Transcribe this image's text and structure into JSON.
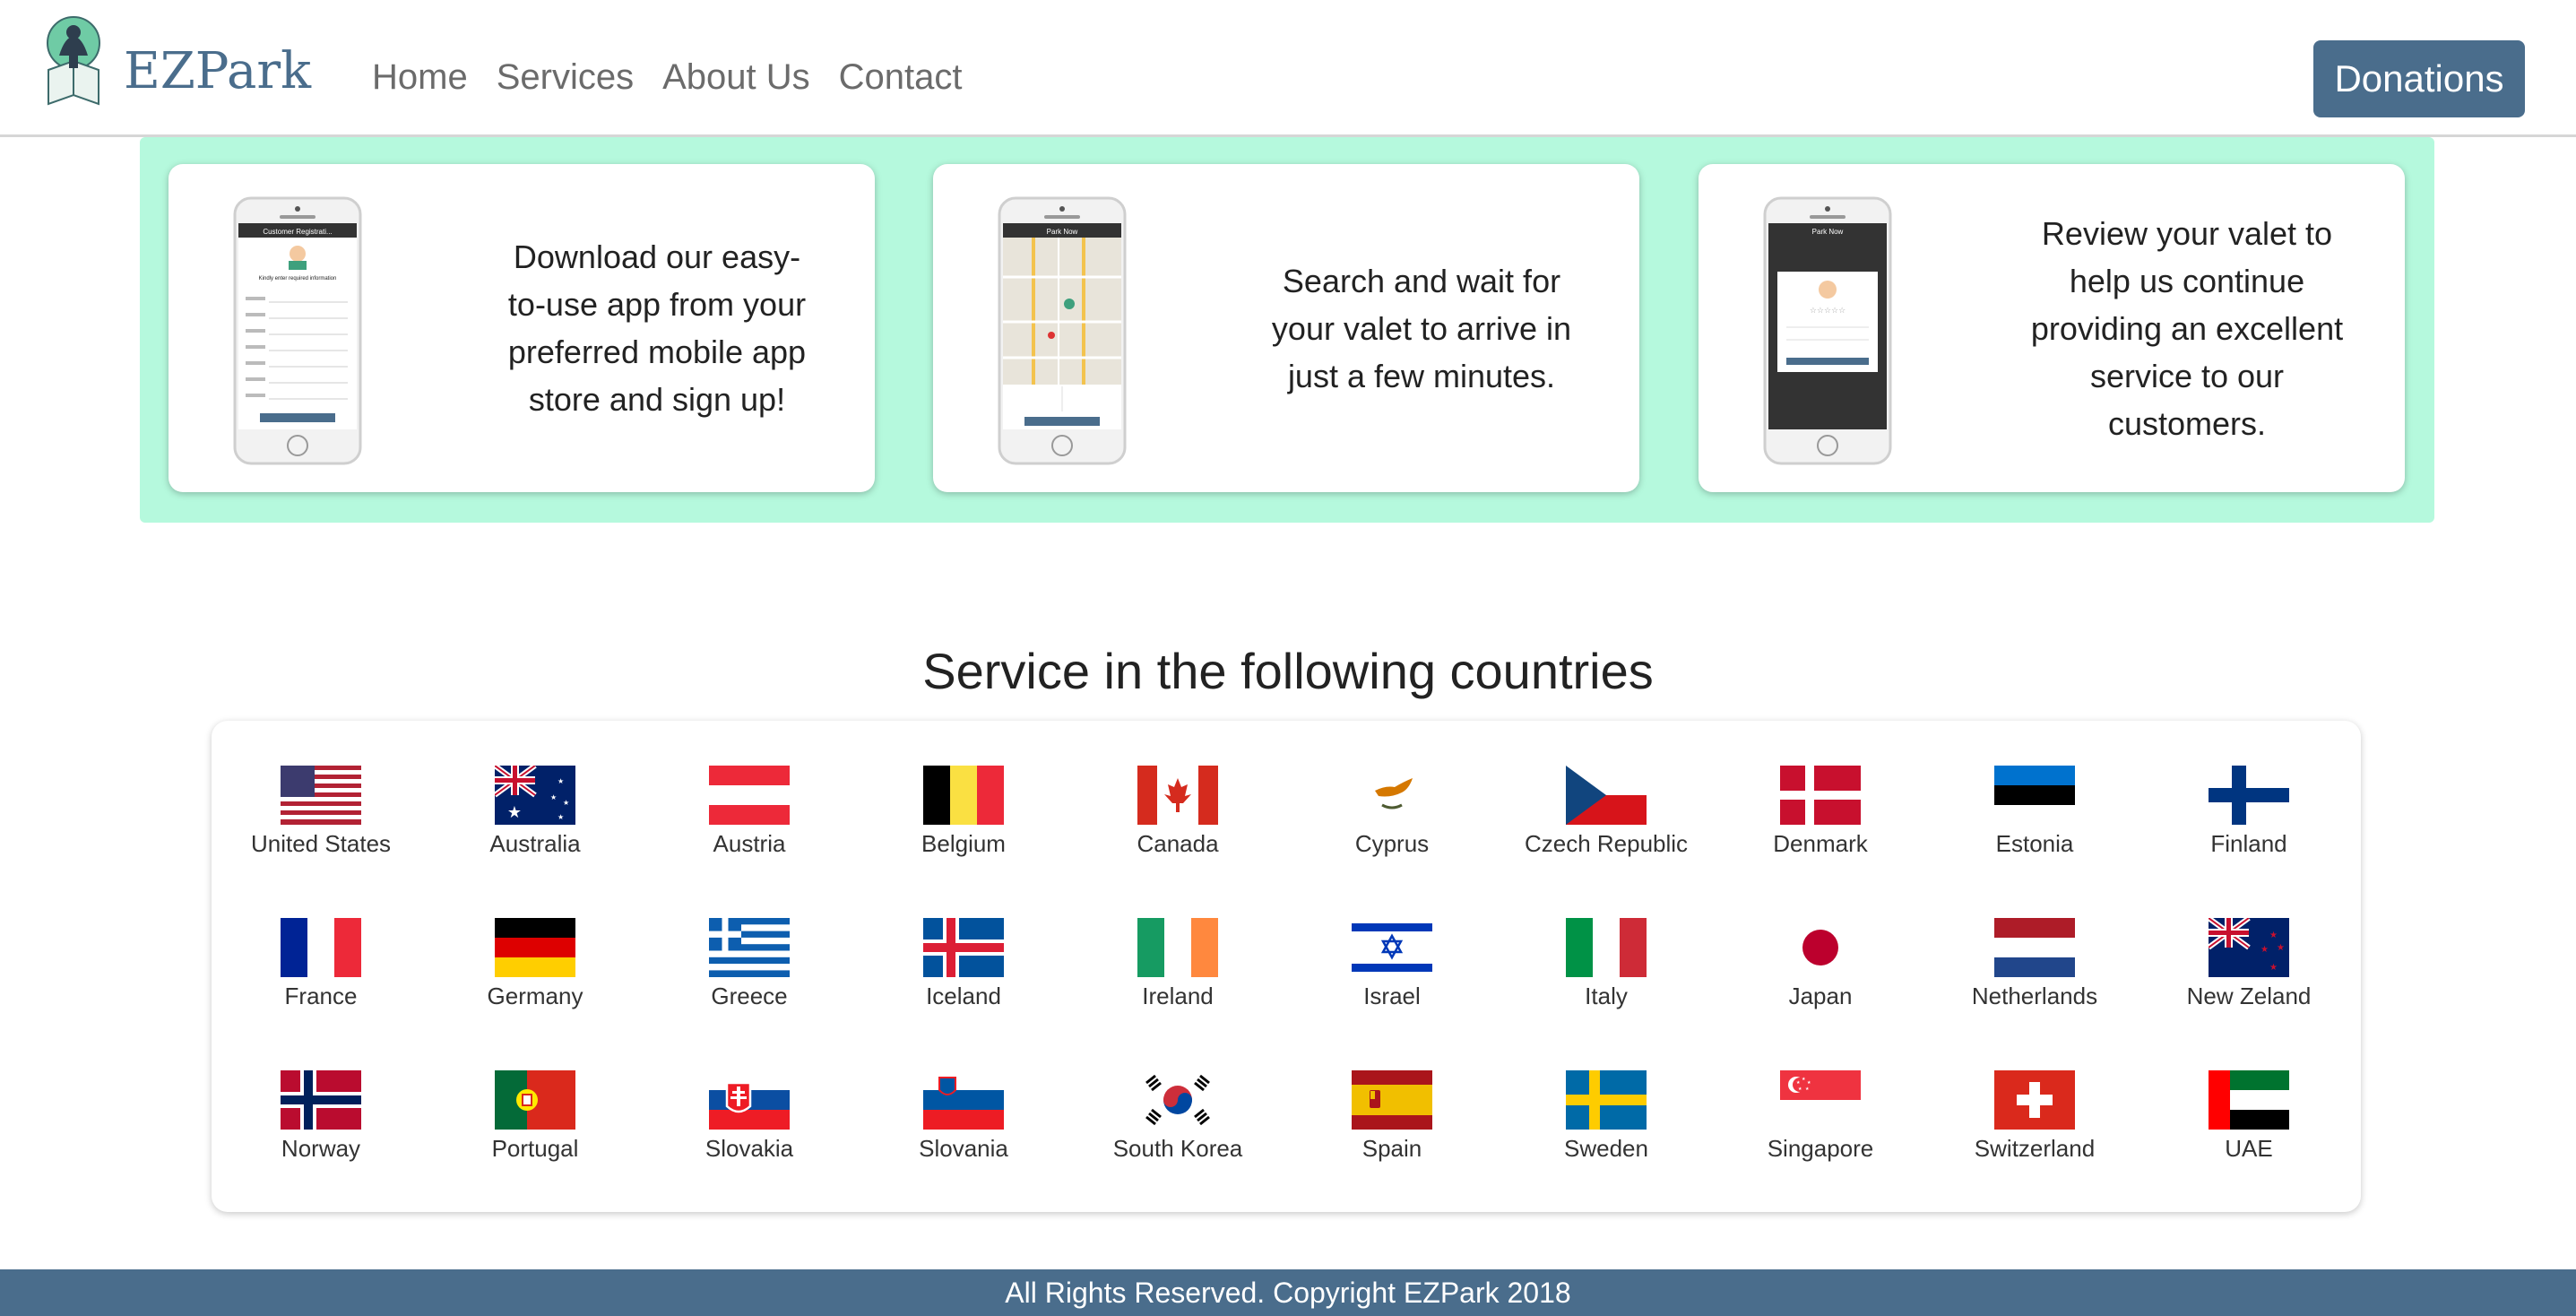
{
  "brand": {
    "name": "EZPark"
  },
  "nav": {
    "links": [
      "Home",
      "Services",
      "About Us",
      "Contact"
    ],
    "donate_label": "Donations"
  },
  "steps": [
    {
      "text": "Download our easy-to-use app from your preferred mobile app store and sign up!",
      "screen_title": "Customer Registrati...",
      "screen_subtitle": "Kindly enter required information"
    },
    {
      "text": "Search and wait for your valet to arrive in just a few minutes.",
      "screen_title": "Park Now"
    },
    {
      "text": "Review your valet to help us continue providing an excellent service to our customers.",
      "screen_title": "Park Now"
    }
  ],
  "countries": {
    "title": "Service in the following countries",
    "items": [
      {
        "name": "United States",
        "icon": "flag-us-icon"
      },
      {
        "name": "Australia",
        "icon": "flag-australia-icon"
      },
      {
        "name": "Austria",
        "icon": "flag-austria-icon"
      },
      {
        "name": "Belgium",
        "icon": "flag-belgium-icon"
      },
      {
        "name": "Canada",
        "icon": "flag-canada-icon"
      },
      {
        "name": "Cyprus",
        "icon": "flag-cyprus-icon"
      },
      {
        "name": "Czech Republic",
        "icon": "flag-czech-icon"
      },
      {
        "name": "Denmark",
        "icon": "flag-denmark-icon"
      },
      {
        "name": "Estonia",
        "icon": "flag-estonia-icon"
      },
      {
        "name": "Finland",
        "icon": "flag-finland-icon"
      },
      {
        "name": "France",
        "icon": "flag-france-icon"
      },
      {
        "name": "Germany",
        "icon": "flag-germany-icon"
      },
      {
        "name": "Greece",
        "icon": "flag-greece-icon"
      },
      {
        "name": "Iceland",
        "icon": "flag-iceland-icon"
      },
      {
        "name": "Ireland",
        "icon": "flag-ireland-icon"
      },
      {
        "name": "Israel",
        "icon": "flag-israel-icon"
      },
      {
        "name": "Italy",
        "icon": "flag-italy-icon"
      },
      {
        "name": "Japan",
        "icon": "flag-japan-icon"
      },
      {
        "name": "Netherlands",
        "icon": "flag-netherlands-icon"
      },
      {
        "name": "New Zeland",
        "icon": "flag-new-zealand-icon"
      },
      {
        "name": "Norway",
        "icon": "flag-norway-icon"
      },
      {
        "name": "Portugal",
        "icon": "flag-portugal-icon"
      },
      {
        "name": "Slovakia",
        "icon": "flag-slovakia-icon"
      },
      {
        "name": "Slovania",
        "icon": "flag-slovenia-icon"
      },
      {
        "name": "South Korea",
        "icon": "flag-south-korea-icon"
      },
      {
        "name": "Spain",
        "icon": "flag-spain-icon"
      },
      {
        "name": "Sweden",
        "icon": "flag-sweden-icon"
      },
      {
        "name": "Singapore",
        "icon": "flag-singapore-icon"
      },
      {
        "name": "Switzerland",
        "icon": "flag-switzerland-icon"
      },
      {
        "name": "UAE",
        "icon": "flag-uae-icon"
      }
    ]
  },
  "footer": {
    "text": "All Rights Reserved. Copyright EZPark 2018"
  },
  "colors": {
    "brand": "#4a6d8c",
    "band": "#b5f9dd"
  }
}
